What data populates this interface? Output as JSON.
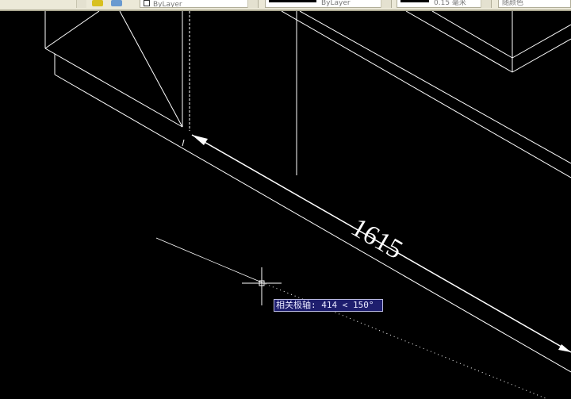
{
  "toolbar": {
    "layer_icons": [
      "layer-state-icon",
      "layer-previous-icon"
    ],
    "color_control": "ByLayer",
    "linetype_control": "ByLayer",
    "lineweight_control": "0.15 毫米",
    "plotstyle_control": "随颜色"
  },
  "drawing": {
    "dimension_value": "1615"
  },
  "tooltip": {
    "label": "相关极轴:",
    "value": "414 < 150°"
  }
}
